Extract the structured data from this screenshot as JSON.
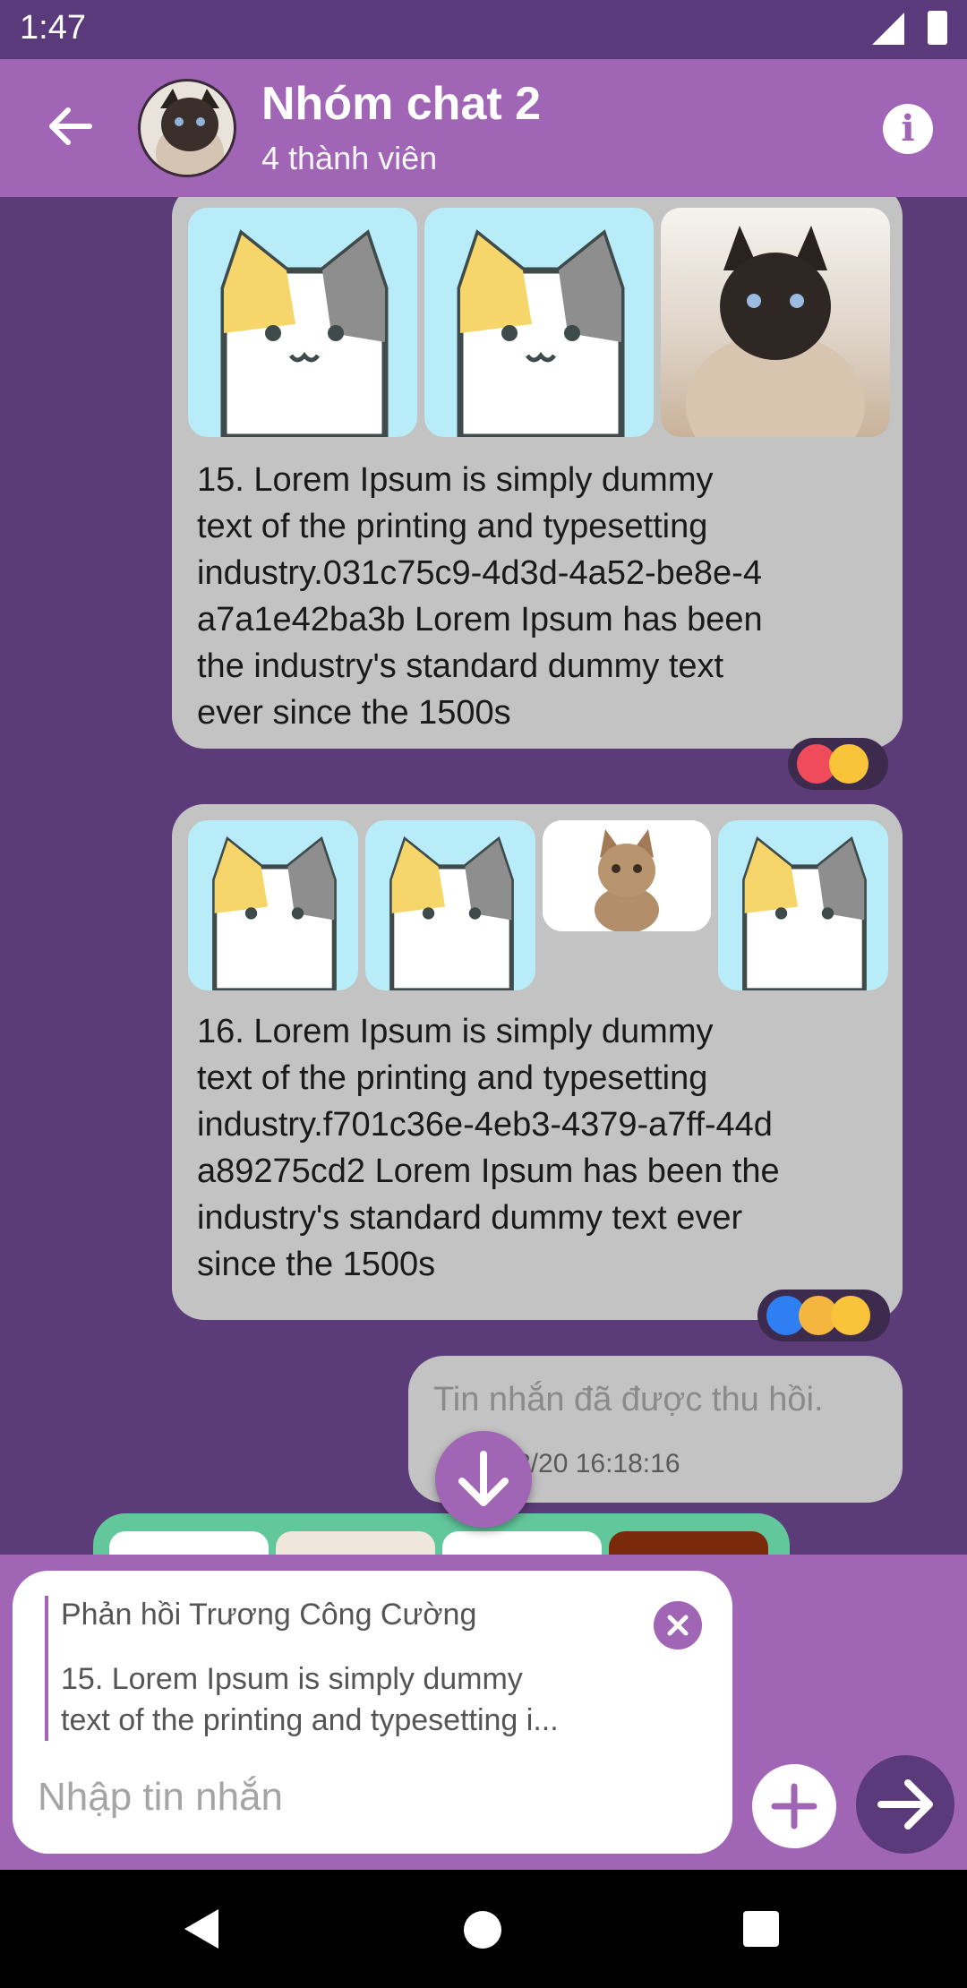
{
  "status_bar": {
    "time": "1:47"
  },
  "header": {
    "title": "Nhóm chat 2",
    "subtitle": "4 thành viên"
  },
  "messages": [
    {
      "text": "15. Lorem Ipsum is simply dummy\ntext of the printing and typesetting\nindustry.031c75c9-4d3d-4a52-be8e-4\na7a1e42ba3b Lorem Ipsum has been\nthe industry's standard dummy text\never since the 1500s",
      "images": [
        "cartoon-cat",
        "cartoon-cat",
        "siamese-cat-photo"
      ],
      "reactions": [
        "heart",
        "wow"
      ]
    },
    {
      "text": "16. Lorem Ipsum is simply dummy\ntext of the printing and typesetting\nindustry.f701c36e-4eb3-4379-a7ff-44d\na89275cd2 Lorem Ipsum has been the\nindustry's standard dummy text ever\nsince the 1500s",
      "images": [
        "cartoon-cat",
        "cartoon-cat",
        "tabby-cat-photo",
        "cartoon-cat"
      ],
      "reactions": [
        "like",
        "sad",
        "wow"
      ]
    },
    {
      "recalled_text": "Tin nhắn đã được thu hồi.",
      "timestamp_visible": "8/20 16:18:16"
    }
  ],
  "reply": {
    "title": "Phản hồi Trương Công Cường",
    "text": "15. Lorem Ipsum is simply dummy\ntext of the printing and typesetting i..."
  },
  "composer": {
    "placeholder": "Nhập tin nhắn"
  },
  "colors": {
    "accent": "#a065b4",
    "background": "#5b3b78",
    "bubble": "#c3c3c3",
    "send": "#5b3a7c"
  }
}
